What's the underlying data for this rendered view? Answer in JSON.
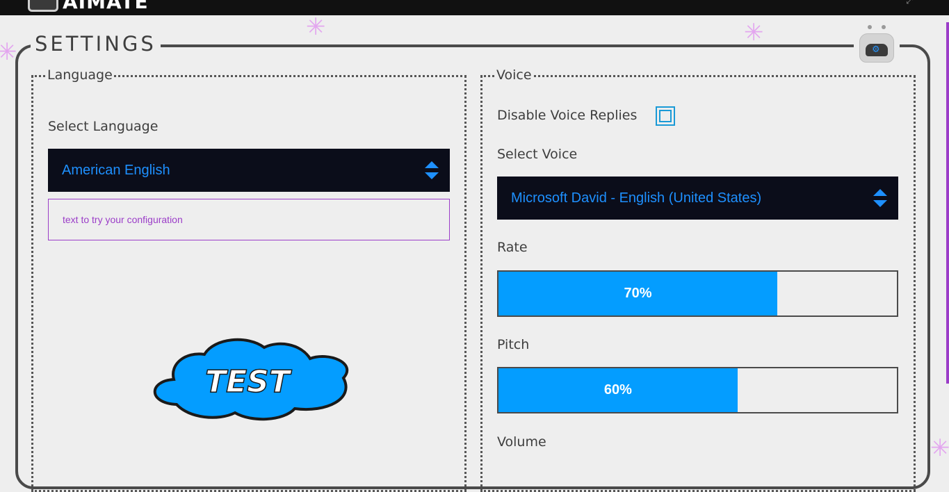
{
  "app": {
    "title": "AIMATE"
  },
  "colors": {
    "accent": "#049dff",
    "select_bg": "#0b0d1a",
    "select_text": "#1e90ff",
    "highlight": "#9b3dc8"
  },
  "settings": {
    "title": "SETTINGS",
    "language": {
      "legend": "Language",
      "select_label": "Select Language",
      "selected_language": "American English",
      "test_input_placeholder": "text to try your configuration",
      "test_button_label": "TEST"
    },
    "voice": {
      "legend": "Voice",
      "disable_label": "Disable Voice Replies",
      "disable_checked": false,
      "select_label": "Select Voice",
      "selected_voice": "Microsoft David - English (United States)",
      "rate": {
        "label": "Rate",
        "value": 70,
        "display": "70%"
      },
      "pitch": {
        "label": "Pitch",
        "value": 60,
        "display": "60%"
      },
      "volume": {
        "label": "Volume"
      }
    }
  }
}
